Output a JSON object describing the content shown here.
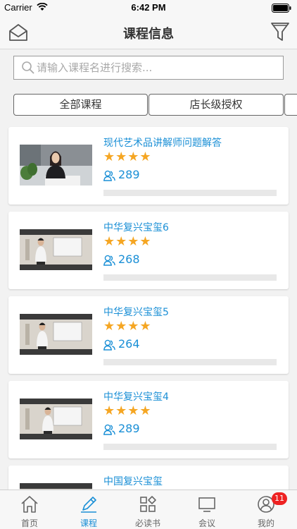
{
  "status_bar": {
    "carrier": "Carrier",
    "time": "6:42 PM"
  },
  "nav": {
    "title": "课程信息",
    "left_icon": "home-envelope-icon",
    "right_icon": "filter-icon"
  },
  "search": {
    "placeholder": "请输入课程名进行搜索..."
  },
  "filters": [
    {
      "label": "全部课程"
    },
    {
      "label": "店长级授权"
    }
  ],
  "courses": [
    {
      "title": "现代艺术品讲解师问题解答",
      "stars": "★★★★",
      "viewers": "289",
      "thumb": "woman-presenter",
      "progress": 0
    },
    {
      "title": "中华复兴宝玺6",
      "stars": "★★★★",
      "viewers": "268",
      "thumb": "man-presenter",
      "progress": 0
    },
    {
      "title": "中华复兴宝玺5",
      "stars": "★★★★",
      "viewers": "264",
      "thumb": "man-presenter",
      "progress": 0
    },
    {
      "title": "中华复兴宝玺4",
      "stars": "★★★★",
      "viewers": "289",
      "thumb": "man-presenter",
      "progress": 0
    },
    {
      "title": "中国复兴宝玺",
      "stars": "",
      "viewers": "",
      "thumb": "man-presenter",
      "progress": 0
    }
  ],
  "tabs": [
    {
      "label": "首页",
      "icon": "home-icon",
      "active": false
    },
    {
      "label": "课程",
      "icon": "pencil-icon",
      "active": true
    },
    {
      "label": "必读书",
      "icon": "grid-icon",
      "active": false
    },
    {
      "label": "会议",
      "icon": "monitor-icon",
      "active": false
    },
    {
      "label": "我的",
      "icon": "user-icon",
      "active": false,
      "badge": "11"
    }
  ],
  "colors": {
    "accent": "#1a8fd6",
    "star": "#f5a623",
    "badge": "#e22222"
  }
}
